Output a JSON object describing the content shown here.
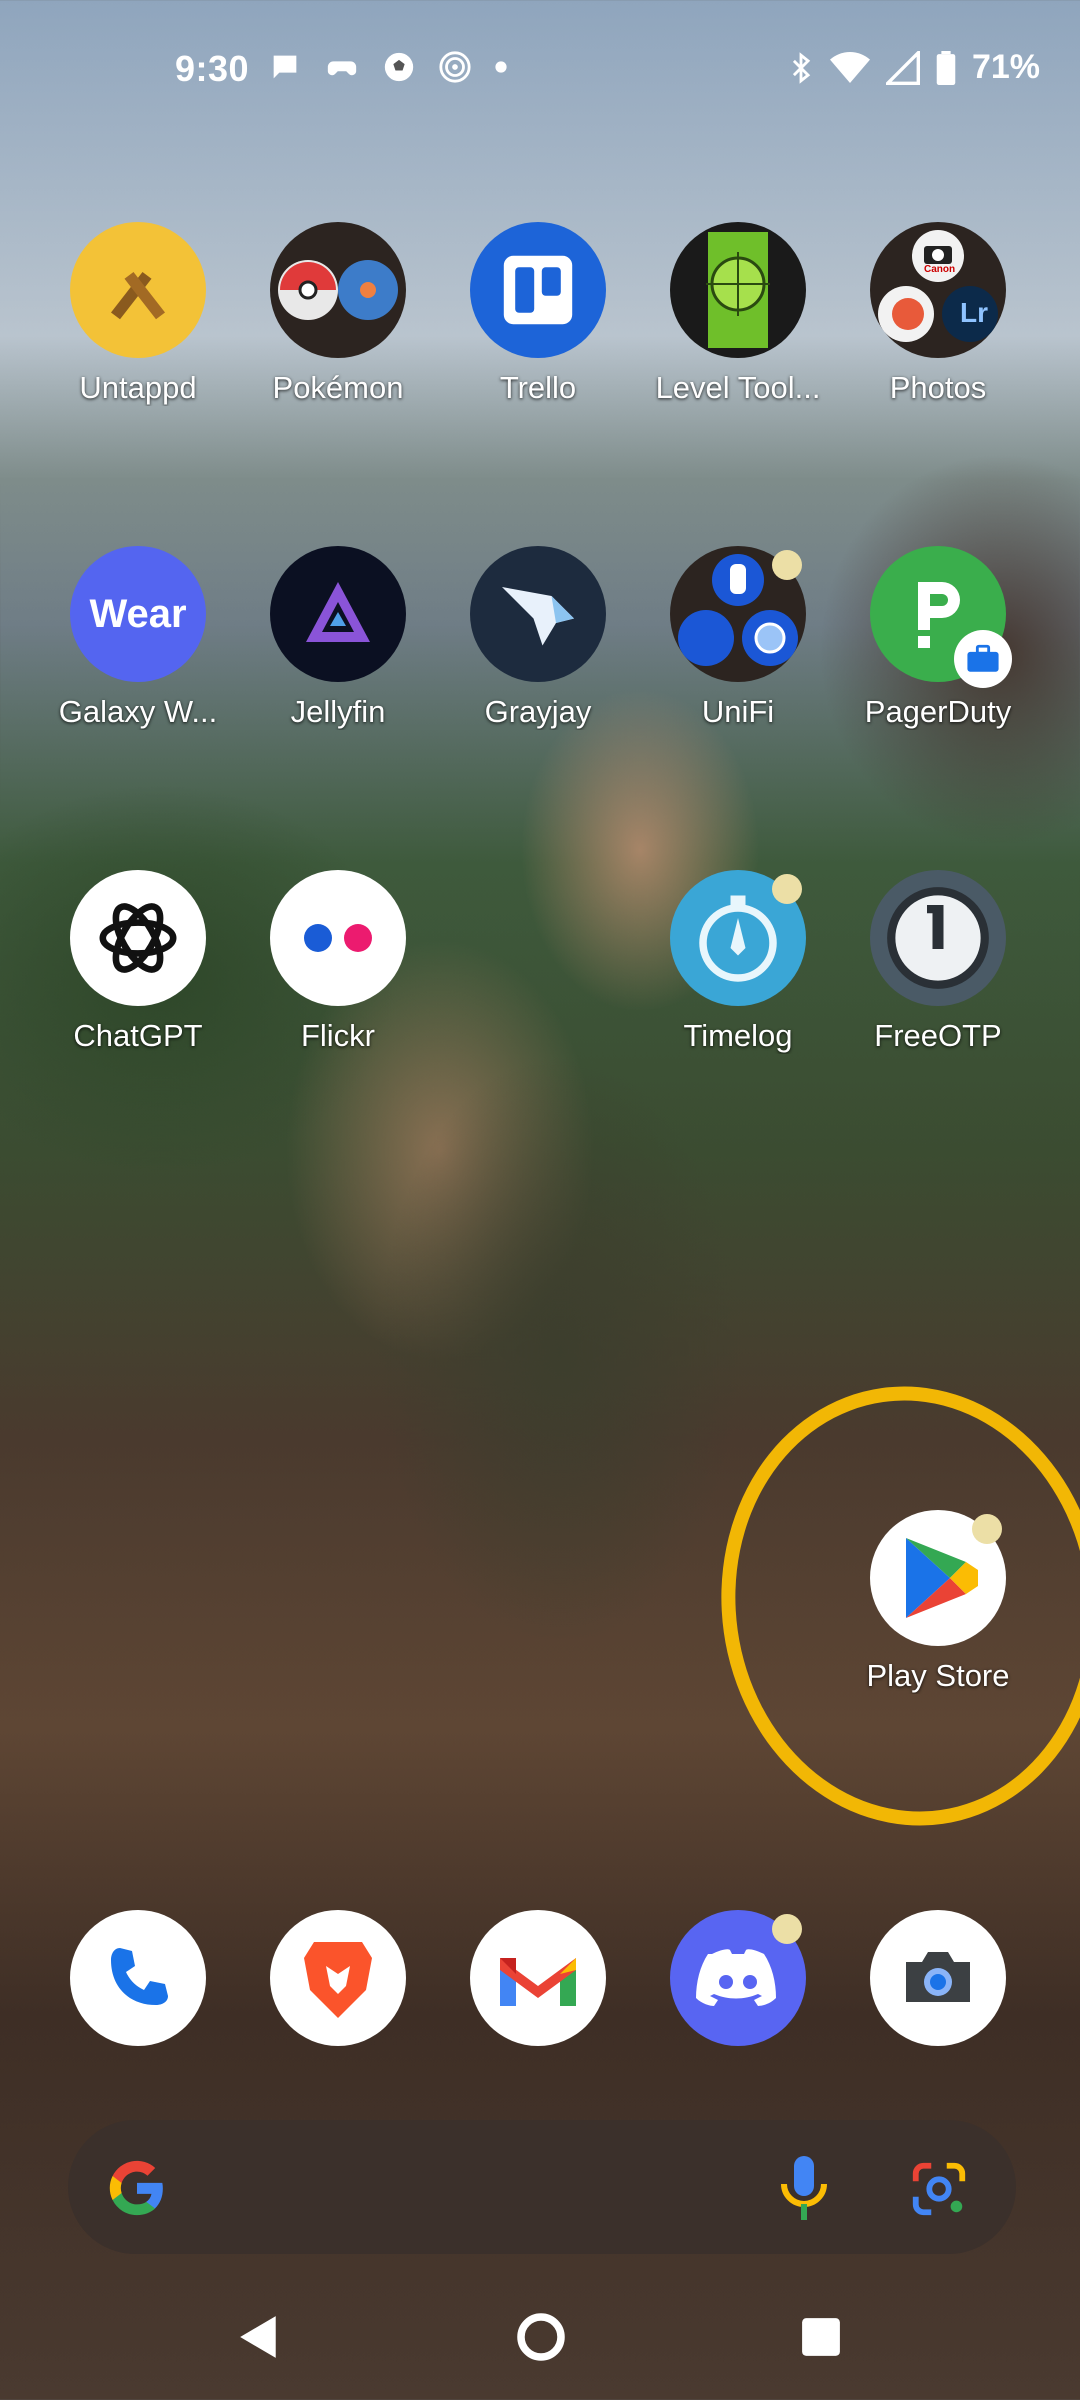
{
  "status_bar": {
    "time": "9:30",
    "battery_percent": "71%",
    "left_icons": [
      "chat-bubble-icon",
      "game-controller-icon",
      "soccer-ball-icon",
      "radar-icon",
      "dot-icon"
    ],
    "right_icons": [
      "bluetooth-icon",
      "wifi-icon",
      "cell-signal-icon",
      "battery-icon"
    ]
  },
  "apps": {
    "untappd": "Untappd",
    "pokemon": "Pokémon",
    "trello": "Trello",
    "level_tool": "Level Tool...",
    "photos": "Photos",
    "galaxy_wear": "Galaxy W...",
    "jellyfin": "Jellyfin",
    "grayjay": "Grayjay",
    "unifi": "UniFi",
    "pagerduty": "PagerDuty",
    "chatgpt": "ChatGPT",
    "flickr": "Flickr",
    "timelog": "Timelog",
    "freeotp": "FreeOTP",
    "play_store": "Play Store"
  },
  "icon_text": {
    "wear": "Wear",
    "lr": "Lr",
    "canon": "Canon"
  },
  "dock": [
    "phone-icon",
    "brave-icon",
    "gmail-icon",
    "discord-icon",
    "camera-icon"
  ],
  "colors": {
    "highlight": "#f2b705",
    "notification_dot": "#ecdfa6",
    "search_bar_bg": "#3b302b"
  }
}
